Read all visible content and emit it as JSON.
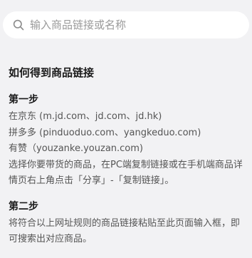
{
  "search": {
    "placeholder": "输入商品链接或名称",
    "icon": "search-icon"
  },
  "help": {
    "title": "如何得到商品链接",
    "step1": {
      "title": "第一步",
      "platforms": [
        "在京东 (m.jd.com、jd.com、jd.hk)",
        "拼多多 (pinduoduo.com、yangkeduo.com)",
        "有赞（youzanke.youzan.com)"
      ],
      "instruction": "选择你要带货的商品，在PC端复制链接或在手机端商品详情页右上角点击「分享」-「复制链接」。"
    },
    "step2": {
      "title": "第二步",
      "instruction": "将符合以上网址规则的商品链接粘贴至此页面输入框，即可搜索出对应商品。"
    }
  }
}
